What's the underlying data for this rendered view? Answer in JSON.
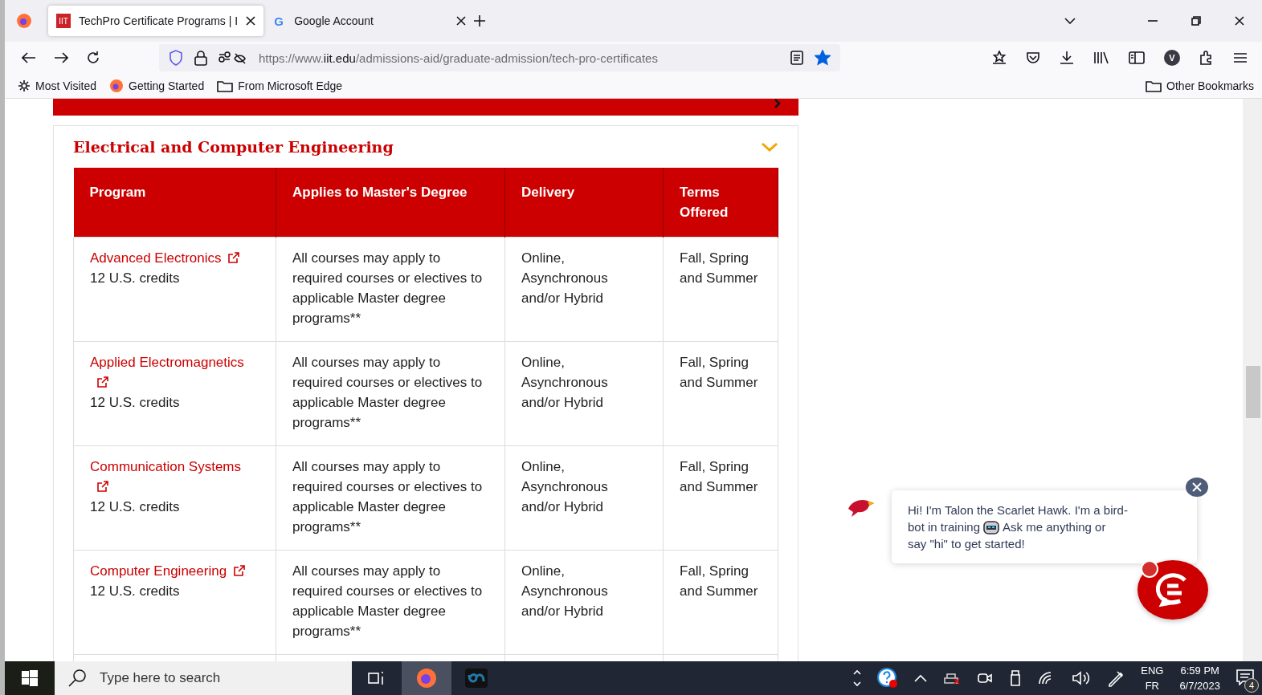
{
  "tabs": [
    {
      "title": "TechPro Certificate Programs | I",
      "favicon": "IIT",
      "selected": true
    },
    {
      "title": "Google Account",
      "favicon": "G",
      "selected": false
    }
  ],
  "address_bar": {
    "prefix": "https://www.",
    "domain": "iit.edu",
    "path": "/admissions-aid/graduate-admission/tech-pro-certificates",
    "bookmarked": true
  },
  "bookmarks": [
    "Most Visited",
    "Getting Started",
    "From Microsoft Edge"
  ],
  "other_bookmarks": "Other Bookmarks",
  "profile_initial": "V",
  "section": {
    "title": "Electrical and Computer Engineering",
    "expanded": true
  },
  "table": {
    "columns": [
      "Program",
      "Applies to Master's Degree",
      "Delivery",
      "Terms Offered"
    ],
    "rows": [
      {
        "program": "Advanced Electronics",
        "credits": "12 U.S. credits",
        "applies": "All courses may apply to required courses or electives to applicable Master degree programs**",
        "delivery": "Online, Asynchronous and/or Hybrid",
        "terms": "Fall, Spring and Summer"
      },
      {
        "program": "Applied Electromagnetics",
        "credits": "12 U.S. credits",
        "applies": "All courses may apply to required courses or electives to applicable Master degree programs**",
        "delivery": "Online, Asynchronous and/or Hybrid",
        "terms": "Fall, Spring and Summer"
      },
      {
        "program": "Communication Systems",
        "credits": "12 U.S. credits",
        "applies": "All courses may apply to required courses or electives to applicable Master degree programs**",
        "delivery": "Online, Asynchronous and/or Hybrid",
        "terms": "Fall, Spring and Summer"
      },
      {
        "program": "Computer Engineering",
        "credits": "12 U.S. credits",
        "applies": "All courses may apply to required courses or electives to applicable Master degree programs**",
        "delivery": "Online, Asynchronous and/or Hybrid",
        "terms": "Fall, Spring and Summer"
      }
    ]
  },
  "chat": {
    "lines": [
      [
        "Hi! I'm Talon the Scarlet Hawk. I'm a bird-"
      ],
      [
        "bot in training",
        "Ask me anything or"
      ],
      [
        "say \"hi\" to get started!"
      ]
    ],
    "unread": true
  },
  "taskbar": {
    "search_placeholder": "Type here to search",
    "language": "ENG",
    "layout": "FR",
    "time": "6:59 PM",
    "date": "6/7/2023",
    "notifications": "4"
  }
}
